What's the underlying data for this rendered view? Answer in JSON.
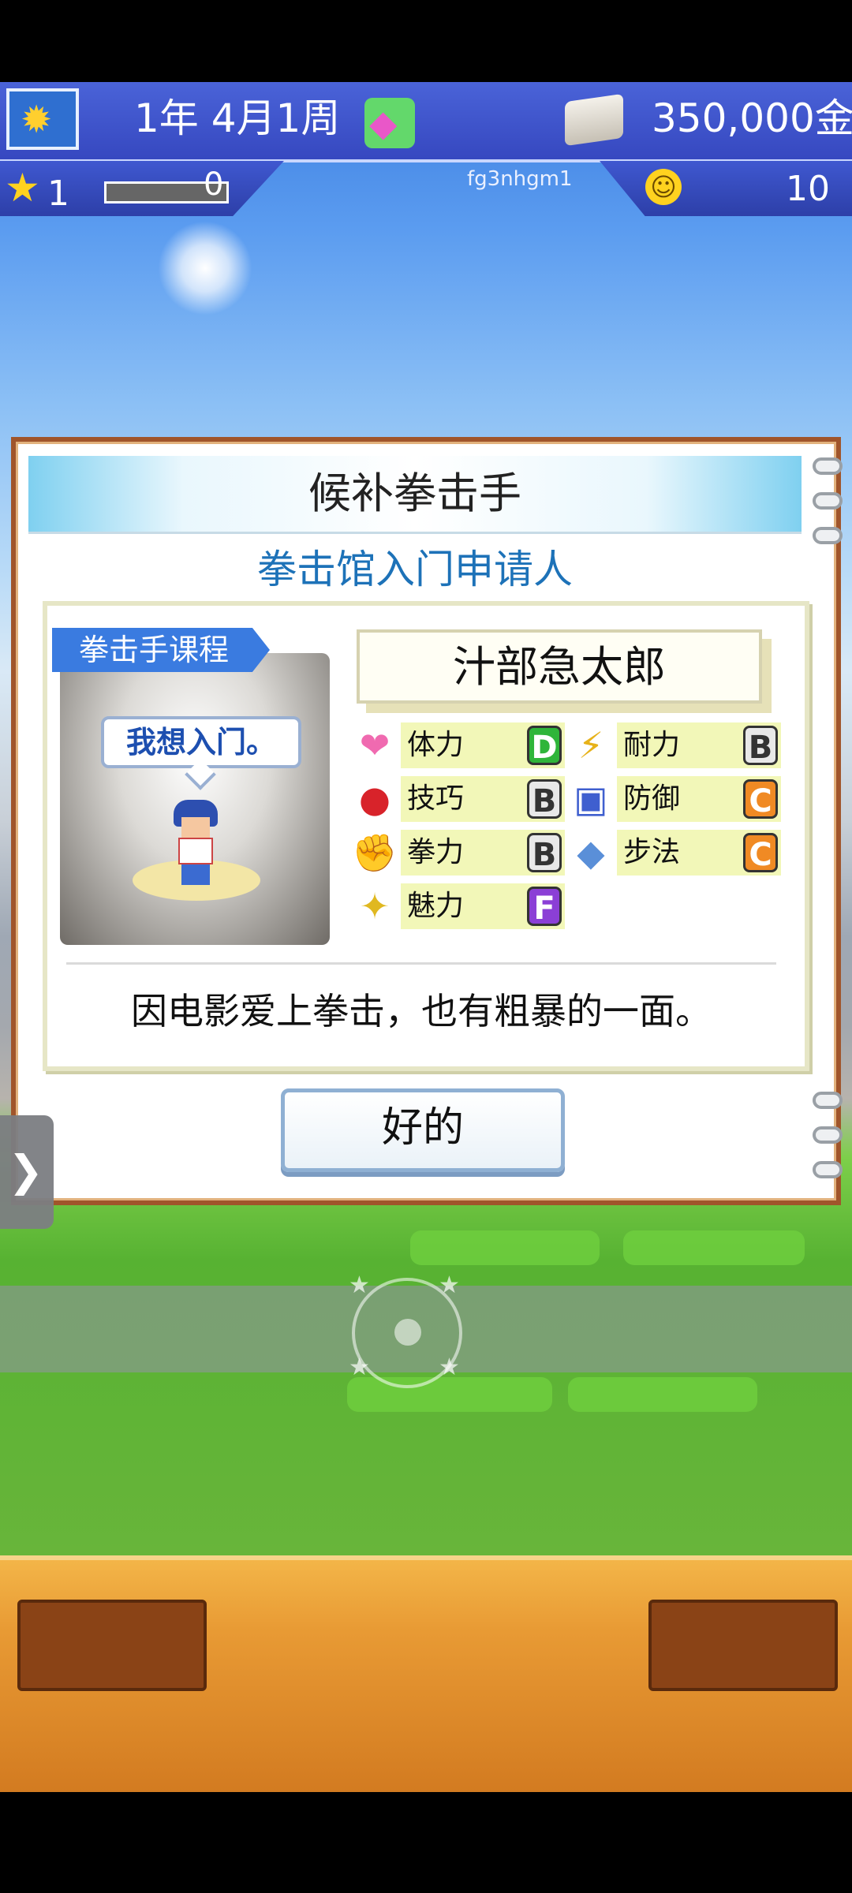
{
  "hud": {
    "date": "1年 4月1周",
    "money": "350,000金",
    "level": "1",
    "xp_value": "0",
    "xp_fraction": 0.0,
    "user_id": "fg3nhgm1",
    "happiness": "10"
  },
  "dialog": {
    "title": "候补拳击手",
    "subtitle": "拳击馆入门申请人",
    "course_tag": "拳击手课程",
    "speech": "我想入门。",
    "name": "汁部急太郎",
    "stats": [
      {
        "label": "体力",
        "grade": "D",
        "icon": "heart-icon",
        "color": "#2fb53a"
      },
      {
        "label": "耐力",
        "grade": "B",
        "icon": "lightning-icon",
        "color": "#e8e8e8"
      },
      {
        "label": "技巧",
        "grade": "B",
        "icon": "boxing-glove-icon",
        "color": "#e8e8e8"
      },
      {
        "label": "防御",
        "grade": "C",
        "icon": "guard-icon",
        "color": "#f08a24"
      },
      {
        "label": "拳力",
        "grade": "B",
        "icon": "flexed-arm-icon",
        "color": "#e8e8e8"
      },
      {
        "label": "步法",
        "grade": "C",
        "icon": "shoe-icon",
        "color": "#f08a24"
      },
      {
        "label": "魅力",
        "grade": "F",
        "icon": "sparkle-icon",
        "color": "#8b3fd6"
      }
    ],
    "description": "因电影爱上拳击，也有粗暴的一面。",
    "ok_label": "好的"
  }
}
